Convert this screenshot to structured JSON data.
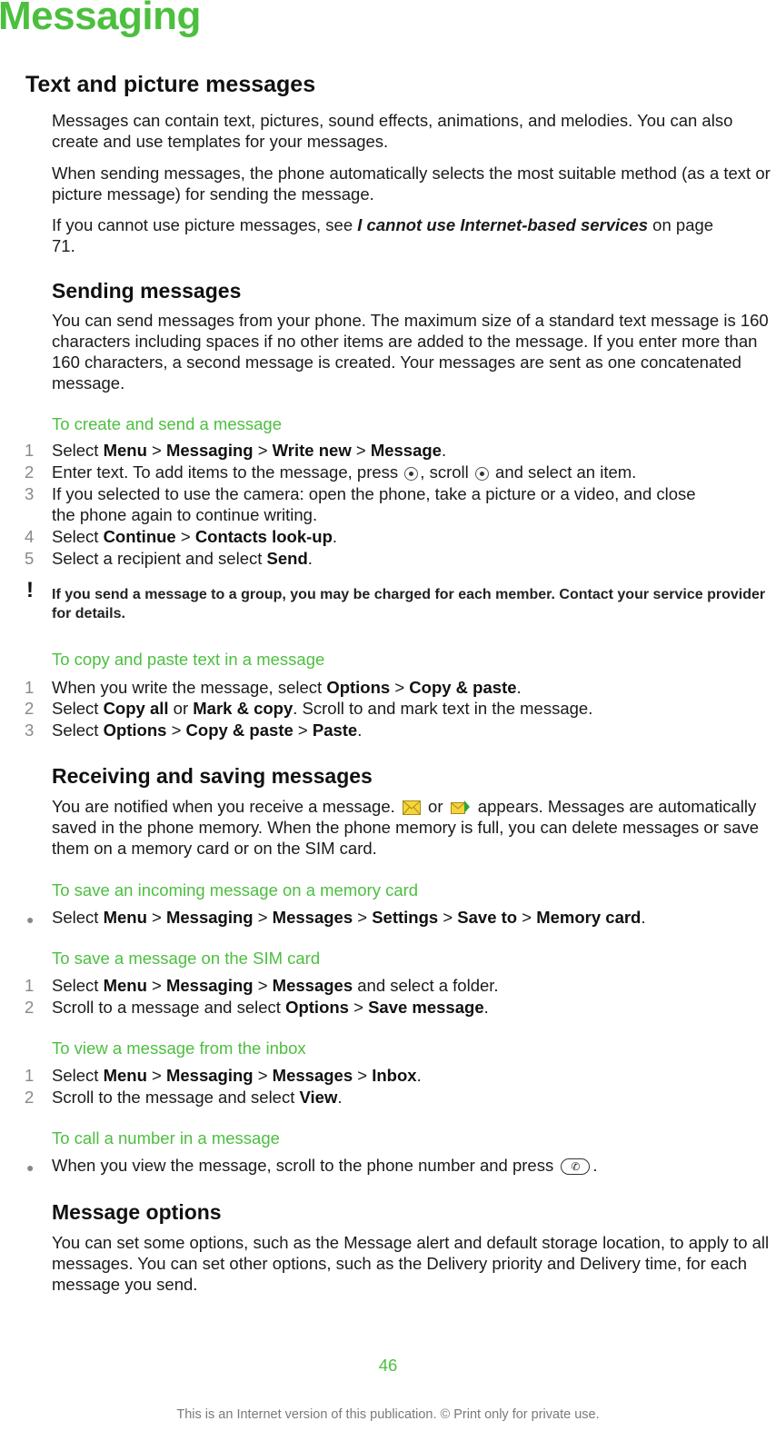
{
  "chapter_title": "Messaging",
  "sections": {
    "text_picture": {
      "heading": "Text and picture messages",
      "p1": "Messages can contain text, pictures, sound effects, animations, and melodies. You can also create and use templates for your messages.",
      "p2": "When sending messages, the phone automatically selects the most suitable method (as a text or picture message) for sending the message.",
      "p3_pre": "If you cannot use picture messages, see ",
      "p3_link": "I cannot use Internet-based services",
      "p3_post": " on page 71."
    },
    "sending": {
      "heading": "Sending messages",
      "p1": "You can send messages from your phone. The maximum size of a standard text message is 160 characters including spaces if no other items are added to the message. If you enter more than 160 characters, a second message is created. Your messages are sent as one concatenated message."
    },
    "create_send": {
      "heading": "To create and send a message",
      "steps": [
        {
          "num": "1",
          "parts": [
            "Select ",
            "Menu",
            " > ",
            "Messaging",
            " > ",
            "Write new",
            " > ",
            "Message",
            "."
          ]
        },
        {
          "num": "2",
          "pre": "Enter text. To add items to the message, press ",
          "mid": ", scroll ",
          "post": " and select an item."
        },
        {
          "num": "3",
          "text": "If you selected to use the camera: open the phone, take a picture or a video, and close the phone again to continue writing."
        },
        {
          "num": "4",
          "parts": [
            "Select ",
            "Continue",
            " > ",
            "Contacts look-up",
            "."
          ]
        },
        {
          "num": "5",
          "parts": [
            "Select a recipient and select ",
            "Send",
            "."
          ]
        }
      ],
      "note": "If you send a message to a group, you may be charged for each member. Contact your service provider for details."
    },
    "copy_paste": {
      "heading": "To copy and paste text in a message",
      "steps": [
        {
          "num": "1",
          "parts": [
            "When you write the message, select ",
            "Options",
            " > ",
            "Copy & paste",
            "."
          ]
        },
        {
          "num": "2",
          "parts": [
            "Select ",
            "Copy all",
            " or ",
            "Mark & copy",
            ". Scroll to and mark text in the message."
          ]
        },
        {
          "num": "3",
          "parts": [
            "Select ",
            "Options",
            " > ",
            "Copy & paste",
            " > ",
            "Paste",
            "."
          ]
        }
      ]
    },
    "receiving": {
      "heading": "Receiving and saving messages",
      "p1_pre": "You are notified when you receive a message. ",
      "p1_or": " or ",
      "p1_post": " appears. Messages are automatically saved in the phone memory. When the phone memory is full, you can delete messages or save them on a memory card or on the SIM card."
    },
    "save_memory": {
      "heading": "To save an incoming message on a memory card",
      "bullet": [
        "Select ",
        "Menu",
        " > ",
        "Messaging",
        " > ",
        "Messages",
        " > ",
        "Settings",
        " > ",
        "Save to",
        " > ",
        "Memory card",
        "."
      ]
    },
    "save_sim": {
      "heading": "To save a message on the SIM card",
      "steps": [
        {
          "num": "1",
          "parts": [
            "Select ",
            "Menu",
            " > ",
            "Messaging",
            " > ",
            "Messages",
            " and select a folder."
          ]
        },
        {
          "num": "2",
          "parts": [
            "Scroll to a message and select ",
            "Options",
            " > ",
            "Save message",
            "."
          ]
        }
      ]
    },
    "view_inbox": {
      "heading": "To view a message from the inbox",
      "steps": [
        {
          "num": "1",
          "parts": [
            "Select ",
            "Menu",
            " > ",
            "Messaging",
            " > ",
            "Messages",
            " > ",
            "Inbox",
            "."
          ]
        },
        {
          "num": "2",
          "parts": [
            "Scroll to the message and select ",
            "View",
            "."
          ]
        }
      ]
    },
    "call_number": {
      "heading": "To call a number in a message",
      "bullet_pre": "When you view the message, scroll to the phone number and press ",
      "bullet_post": "."
    },
    "options": {
      "heading": "Message options",
      "p1": "You can set some options, such as the Message alert and default storage location, to apply to all messages. You can set other options, such as the Delivery priority and Delivery time, for each message you send."
    }
  },
  "icons": {
    "nav_select": "navigation-key-select",
    "nav_scroll": "navigation-key-scroll",
    "new_message": "envelope-icon",
    "new_mms": "envelope-arrow-icon",
    "call_key": "call-key-icon",
    "note": "!"
  },
  "page_number": "46",
  "footer": "This is an Internet version of this publication. © Print only for private use.",
  "colors": {
    "accent": "#4cbf3f",
    "step_number": "#888888",
    "footer": "#7a7a7a"
  }
}
